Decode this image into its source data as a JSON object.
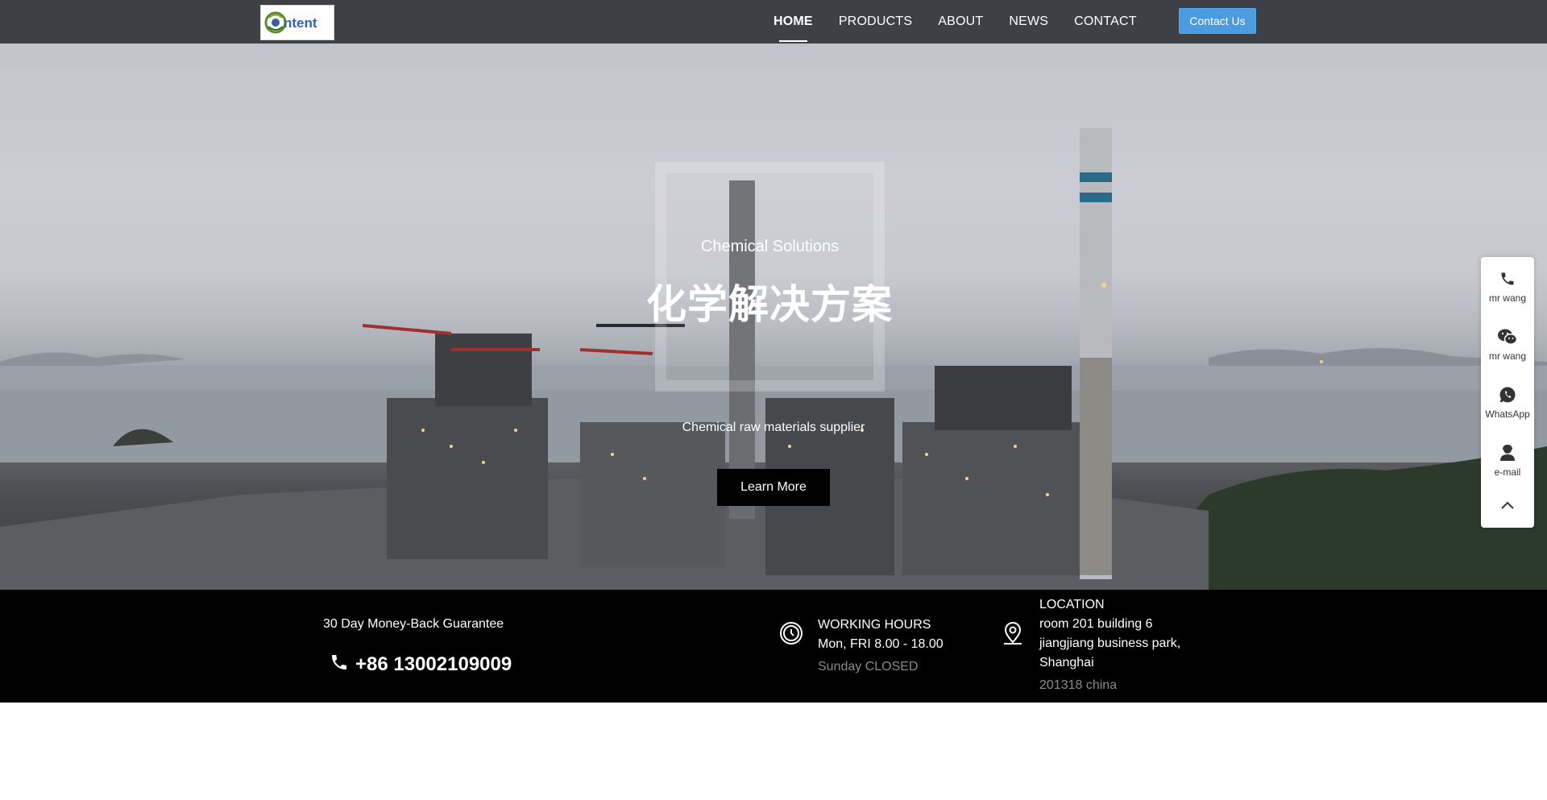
{
  "nav": {
    "logo_text": "Content",
    "links": [
      "HOME",
      "PRODUCTS",
      "ABOUT",
      "NEWS",
      "CONTACT"
    ],
    "active": "HOME",
    "cta_label": "Contact Us",
    "cta_color": "#4a9be0"
  },
  "hero": {
    "subtitle": "Chemical Solutions",
    "title": "化学解决方案",
    "description": "Chemical raw materials supplier",
    "button_label": "Learn More"
  },
  "info": {
    "guarantee": "30 Day Money-Back Guarantee",
    "phone": "+86 13002109009",
    "hours_title": "WORKING HOURS",
    "hours_value": "Mon, FRI 8.00 - 18.00",
    "hours_note": "Sunday CLOSED",
    "location_title": "LOCATION",
    "location_lines": [
      "room 201 building 6",
      "jiangjiang business park,",
      "Shanghai"
    ],
    "location_note": "201318 china"
  },
  "sidebar": {
    "items": [
      {
        "icon": "phone-icon",
        "label": "mr wang"
      },
      {
        "icon": "wechat-icon",
        "label": "mr wang"
      },
      {
        "icon": "whatsapp-icon",
        "label": "WhatsApp"
      },
      {
        "icon": "email-icon",
        "label": "e-mail"
      }
    ],
    "top_icon": "chevron-up-icon"
  }
}
